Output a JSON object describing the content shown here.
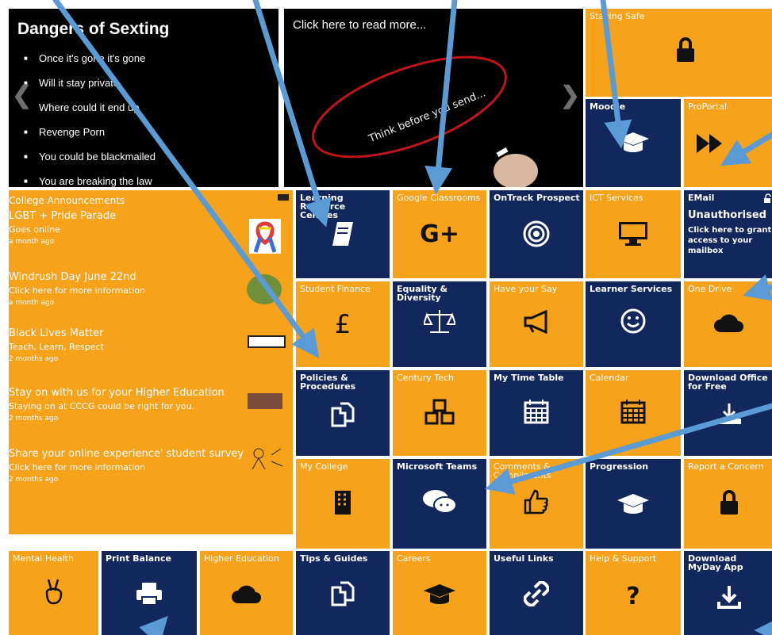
{
  "slides": {
    "sexting": {
      "title": "Dangers of Sexting",
      "bullets": [
        "Once it's gone it's gone",
        "Will it stay private",
        "Where could it end up",
        "Revenge Porn",
        "You could be blackmailed",
        "You are breaking the law"
      ]
    },
    "think": {
      "caption": "Click here to read more...",
      "ellipse_text": "Think before you send..."
    }
  },
  "announcements": {
    "header": "College Announcements",
    "items": [
      {
        "title": "LGBT + Pride Parade",
        "subtitle": "Goes online",
        "date": "a month ago"
      },
      {
        "title": "Windrush Day June 22nd",
        "subtitle": "Click here for more information",
        "date": "a month ago"
      },
      {
        "title": "Black Lives Matter",
        "subtitle": "Teach, Learn, Respect",
        "date": "2 months ago"
      },
      {
        "title": "Stay on with us for your Higher Education",
        "subtitle": "Staying on at CCCG could be right for you.",
        "date": "2 months ago"
      },
      {
        "title": "Share your online experience' student survey",
        "subtitle": "Click here for more information",
        "date": "2 months ago"
      }
    ]
  },
  "tiles": {
    "staying_safe": {
      "label": "Staying Safe",
      "icon": "lock-icon"
    },
    "moodle": {
      "label": "Moodle",
      "icon": "graduation-cap-icon"
    },
    "proportal": {
      "label": "ProPortal",
      "icon": "fast-forward-icon"
    },
    "learning_resource": {
      "label": "Learning Resource Centres",
      "icon": "book-icon"
    },
    "google_classrooms": {
      "label": "Google Classrooms",
      "icon": "google-plus-icon",
      "glyph": "G+"
    },
    "ontrack": {
      "label": "OnTrack Prospect",
      "icon": "target-icon"
    },
    "ict": {
      "label": "ICT Services",
      "icon": "monitor-icon"
    },
    "email": {
      "label": "EMail",
      "status": "Unauthorised",
      "message": "Click here to grant access to your mailbox"
    },
    "student_finance": {
      "label": "Student Finance",
      "icon": "pound-icon",
      "glyph": "£"
    },
    "equality": {
      "label": "Equality & Diversity",
      "icon": "scales-icon"
    },
    "have_your_say": {
      "label": "Have your Say",
      "icon": "megaphone-icon"
    },
    "learner_services": {
      "label": "Learner Services",
      "icon": "smiley-icon"
    },
    "one_drive": {
      "label": "One Drive",
      "icon": "cloud-icon"
    },
    "policies": {
      "label": "Policies & Procedures",
      "icon": "copy-icon"
    },
    "century_tech": {
      "label": "Century Tech",
      "icon": "cubes-icon"
    },
    "timetable": {
      "label": "My Time Table",
      "icon": "calendar-icon"
    },
    "calendar": {
      "label": "Calendar",
      "icon": "calendar-icon"
    },
    "download_office": {
      "label": "Download Office for Free",
      "icon": "download-tray-icon"
    },
    "my_college": {
      "label": "My College",
      "icon": "building-icon"
    },
    "ms_teams": {
      "label": "Microsoft Teams",
      "icon": "chat-icon"
    },
    "compliments": {
      "label": "Comments & Compliments",
      "icon": "thumbs-up-icon"
    },
    "progression": {
      "label": "Progression",
      "icon": "graduation-cap-icon"
    },
    "report_concern": {
      "label": "Report a Concern",
      "icon": "lock-icon"
    },
    "mental_health": {
      "label": "Mental Health",
      "icon": "peace-hand-icon"
    },
    "print_balance": {
      "label": "Print Balance",
      "icon": "printer-icon"
    },
    "higher_education": {
      "label": "Higher Education",
      "icon": "cloud-icon"
    },
    "tips_guides": {
      "label": "Tips & Guides",
      "icon": "copy-icon"
    },
    "careers": {
      "label": "Careers",
      "icon": "graduation-cap-icon"
    },
    "useful_links": {
      "label": "Useful Links",
      "icon": "link-icon"
    },
    "help_support": {
      "label": "Help & Support",
      "icon": "question-icon",
      "glyph": "?"
    },
    "download_myday": {
      "label": "Download MyDay App",
      "icon": "download-icon"
    }
  },
  "colors": {
    "orange": "#F7A21B",
    "navy": "#12285C",
    "arrow": "#5B9BD5"
  }
}
